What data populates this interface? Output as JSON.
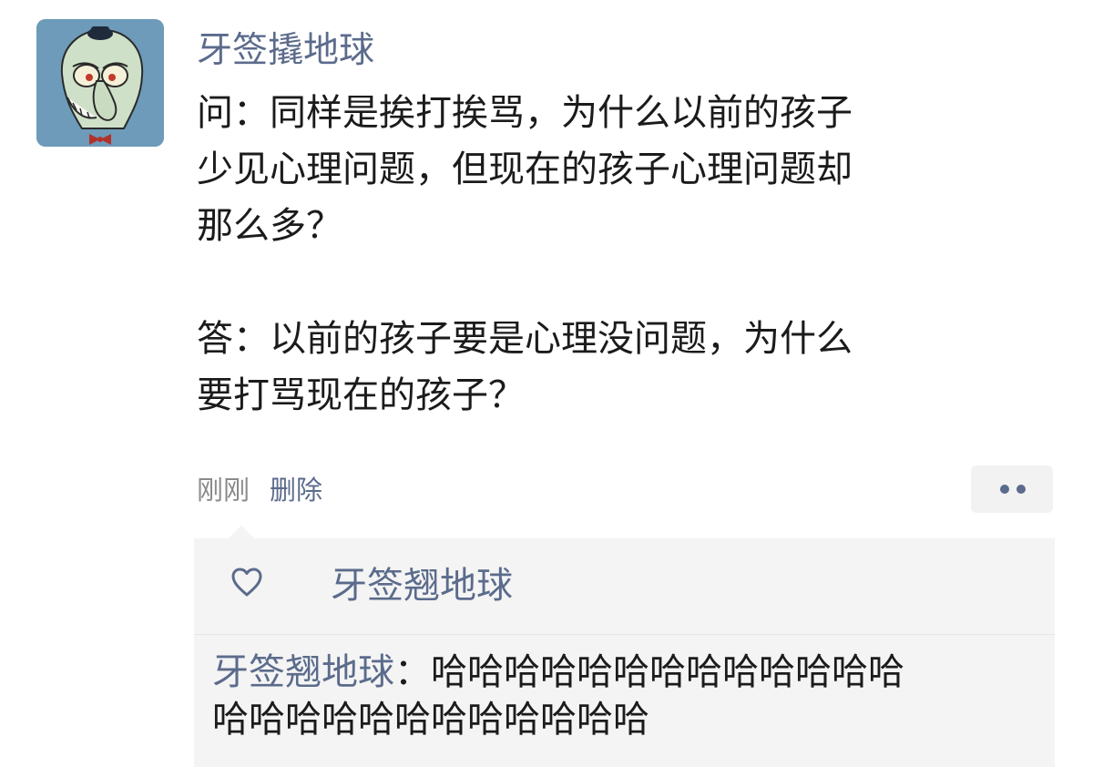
{
  "post": {
    "author": "牙签撬地球",
    "lines": [
      "问：同样是挨打挨骂，为什么以前的孩子",
      "少见心理问题，但现在的孩子心理问题却",
      "那么多？",
      "答：以前的孩子要是心理没问题，为什么",
      "要打骂现在的孩子？"
    ],
    "time": "刚刚",
    "delete_label": "删除"
  },
  "interactions": {
    "like_icon": "heart-outline-icon",
    "liked_by": "牙签翘地球",
    "comment": {
      "author": "牙签翘地球",
      "separator": "：",
      "text_line1": "哈哈哈哈哈哈哈哈哈哈哈哈哈",
      "text_line2": "哈哈哈哈哈哈哈哈哈哈哈哈"
    }
  },
  "colors": {
    "link_blue": "#5b6b8c",
    "panel_bg": "#f4f4f4",
    "avatar_bg": "#6d9bb9"
  }
}
